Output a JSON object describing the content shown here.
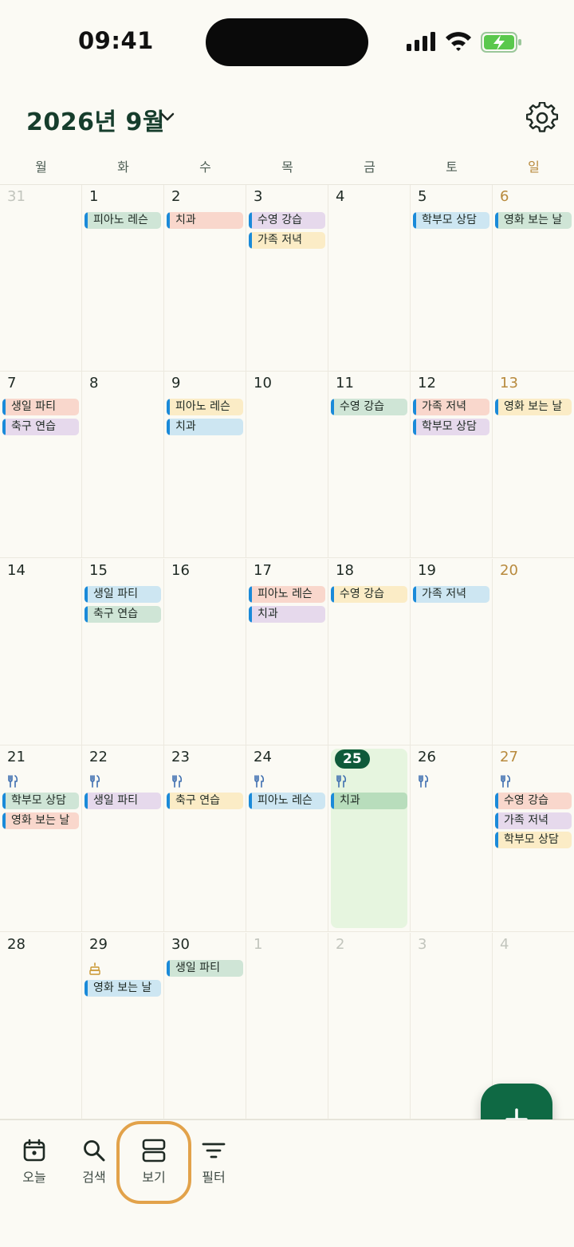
{
  "status_bar": {
    "time": "09:41"
  },
  "header": {
    "month_title": "2026년 9월"
  },
  "weekdays": [
    "월",
    "화",
    "수",
    "목",
    "금",
    "토",
    "일"
  ],
  "weeks": [
    {
      "days": [
        {
          "num": "31",
          "other": true,
          "events": []
        },
        {
          "num": "1",
          "events": [
            {
              "title": "피아노 레슨",
              "color": "green"
            }
          ]
        },
        {
          "num": "2",
          "events": [
            {
              "title": "치과",
              "color": "red"
            }
          ]
        },
        {
          "num": "3",
          "events": [
            {
              "title": "수영 강습",
              "color": "purple"
            },
            {
              "title": "가족 저녁",
              "color": "yellow",
              "noline": true
            }
          ]
        },
        {
          "num": "4",
          "events": []
        },
        {
          "num": "5",
          "events": [
            {
              "title": "학부모 상담",
              "color": "blue"
            }
          ]
        },
        {
          "num": "6",
          "sunday": true,
          "events": [
            {
              "title": "영화 보는 날",
              "color": "green"
            }
          ]
        }
      ]
    },
    {
      "days": [
        {
          "num": "7",
          "events": [
            {
              "title": "생일 파티",
              "color": "red"
            },
            {
              "title": "축구 연습",
              "color": "purple"
            }
          ]
        },
        {
          "num": "8",
          "events": []
        },
        {
          "num": "9",
          "events": [
            {
              "title": "피아노 레슨",
              "color": "yellow"
            },
            {
              "title": "치과",
              "color": "blue"
            }
          ]
        },
        {
          "num": "10",
          "events": []
        },
        {
          "num": "11",
          "events": [
            {
              "title": "수영 강습",
              "color": "green"
            }
          ]
        },
        {
          "num": "12",
          "events": [
            {
              "title": "가족 저녁",
              "color": "red"
            },
            {
              "title": "학부모 상담",
              "color": "purple"
            }
          ]
        },
        {
          "num": "13",
          "sunday": true,
          "events": [
            {
              "title": "영화 보는 날",
              "color": "yellow"
            }
          ]
        }
      ]
    },
    {
      "days": [
        {
          "num": "14",
          "events": []
        },
        {
          "num": "15",
          "events": [
            {
              "title": "생일 파티",
              "color": "blue"
            },
            {
              "title": "축구 연습",
              "color": "green"
            }
          ]
        },
        {
          "num": "16",
          "events": []
        },
        {
          "num": "17",
          "events": [
            {
              "title": "피아노 레슨",
              "color": "red"
            },
            {
              "title": "치과",
              "color": "purple",
              "noline": true
            }
          ]
        },
        {
          "num": "18",
          "events": [
            {
              "title": "수영 강습",
              "color": "yellow"
            }
          ]
        },
        {
          "num": "19",
          "events": [
            {
              "title": "가족 저녁",
              "color": "blue"
            }
          ]
        },
        {
          "num": "20",
          "sunday": true,
          "events": []
        }
      ]
    },
    {
      "days": [
        {
          "num": "21",
          "icon": "fork-knife",
          "events": [
            {
              "title": "학부모 상담",
              "color": "green"
            },
            {
              "title": "영화 보는 날",
              "color": "red"
            }
          ]
        },
        {
          "num": "22",
          "icon": "fork-knife",
          "events": [
            {
              "title": "생일 파티",
              "color": "purple"
            }
          ]
        },
        {
          "num": "23",
          "icon": "fork-knife",
          "events": [
            {
              "title": "축구 연습",
              "color": "yellow"
            }
          ]
        },
        {
          "num": "24",
          "icon": "fork-knife",
          "events": [
            {
              "title": "피아노 레슨",
              "color": "blue"
            }
          ]
        },
        {
          "num": "25",
          "today": true,
          "icon": "fork-knife",
          "events": [
            {
              "title": "치과",
              "color": "todaygreen"
            }
          ]
        },
        {
          "num": "26",
          "icon": "fork-knife",
          "events": []
        },
        {
          "num": "27",
          "sunday": true,
          "icon": "fork-knife",
          "events": [
            {
              "title": "수영 강습",
              "color": "red"
            },
            {
              "title": "가족 저녁",
              "color": "purple"
            },
            {
              "title": "학부모 상담",
              "color": "yellow"
            }
          ]
        }
      ]
    },
    {
      "days": [
        {
          "num": "28",
          "events": []
        },
        {
          "num": "29",
          "icon": "cake",
          "events": [
            {
              "title": "영화 보는 날",
              "color": "blue"
            }
          ]
        },
        {
          "num": "30",
          "events": [
            {
              "title": "생일 파티",
              "color": "green",
              "noline": true
            }
          ]
        },
        {
          "num": "1",
          "other": true,
          "events": []
        },
        {
          "num": "2",
          "other": true,
          "events": []
        },
        {
          "num": "3",
          "other": true,
          "events": []
        },
        {
          "num": "4",
          "other": true,
          "events": []
        }
      ]
    }
  ],
  "bottom_nav": [
    {
      "label": "오늘",
      "icon": "calendar-today-icon"
    },
    {
      "label": "검색",
      "icon": "search-icon"
    },
    {
      "label": "보기",
      "icon": "view-icon"
    },
    {
      "label": "필터",
      "icon": "filter-icon"
    }
  ],
  "colors": {
    "accent": "#0f6944",
    "sunday": "#b88a3d",
    "event_bar": "#1a8ad9",
    "highlight": "#e2a24a"
  }
}
